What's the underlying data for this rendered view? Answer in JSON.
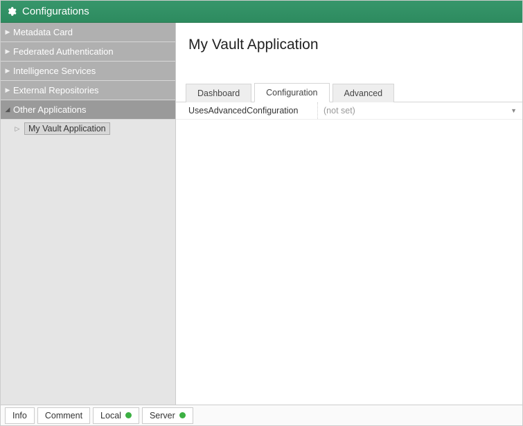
{
  "header": {
    "title": "Configurations"
  },
  "sidebar": {
    "items": [
      {
        "label": "Metadata Card"
      },
      {
        "label": "Federated Authentication"
      },
      {
        "label": "Intelligence Services"
      },
      {
        "label": "External Repositories"
      },
      {
        "label": "Other Applications"
      }
    ],
    "child": {
      "label": "My Vault Application"
    }
  },
  "main": {
    "title": "My Vault Application",
    "tabs": [
      {
        "label": "Dashboard"
      },
      {
        "label": "Configuration"
      },
      {
        "label": "Advanced"
      }
    ],
    "active_tab_index": 1,
    "property": {
      "key": "UsesAdvancedConfiguration",
      "value": "(not set)"
    }
  },
  "footer": {
    "buttons": [
      {
        "label": "Info"
      },
      {
        "label": "Comment"
      },
      {
        "label": "Local",
        "status_dot": true
      },
      {
        "label": "Server",
        "status_dot": true
      }
    ]
  }
}
